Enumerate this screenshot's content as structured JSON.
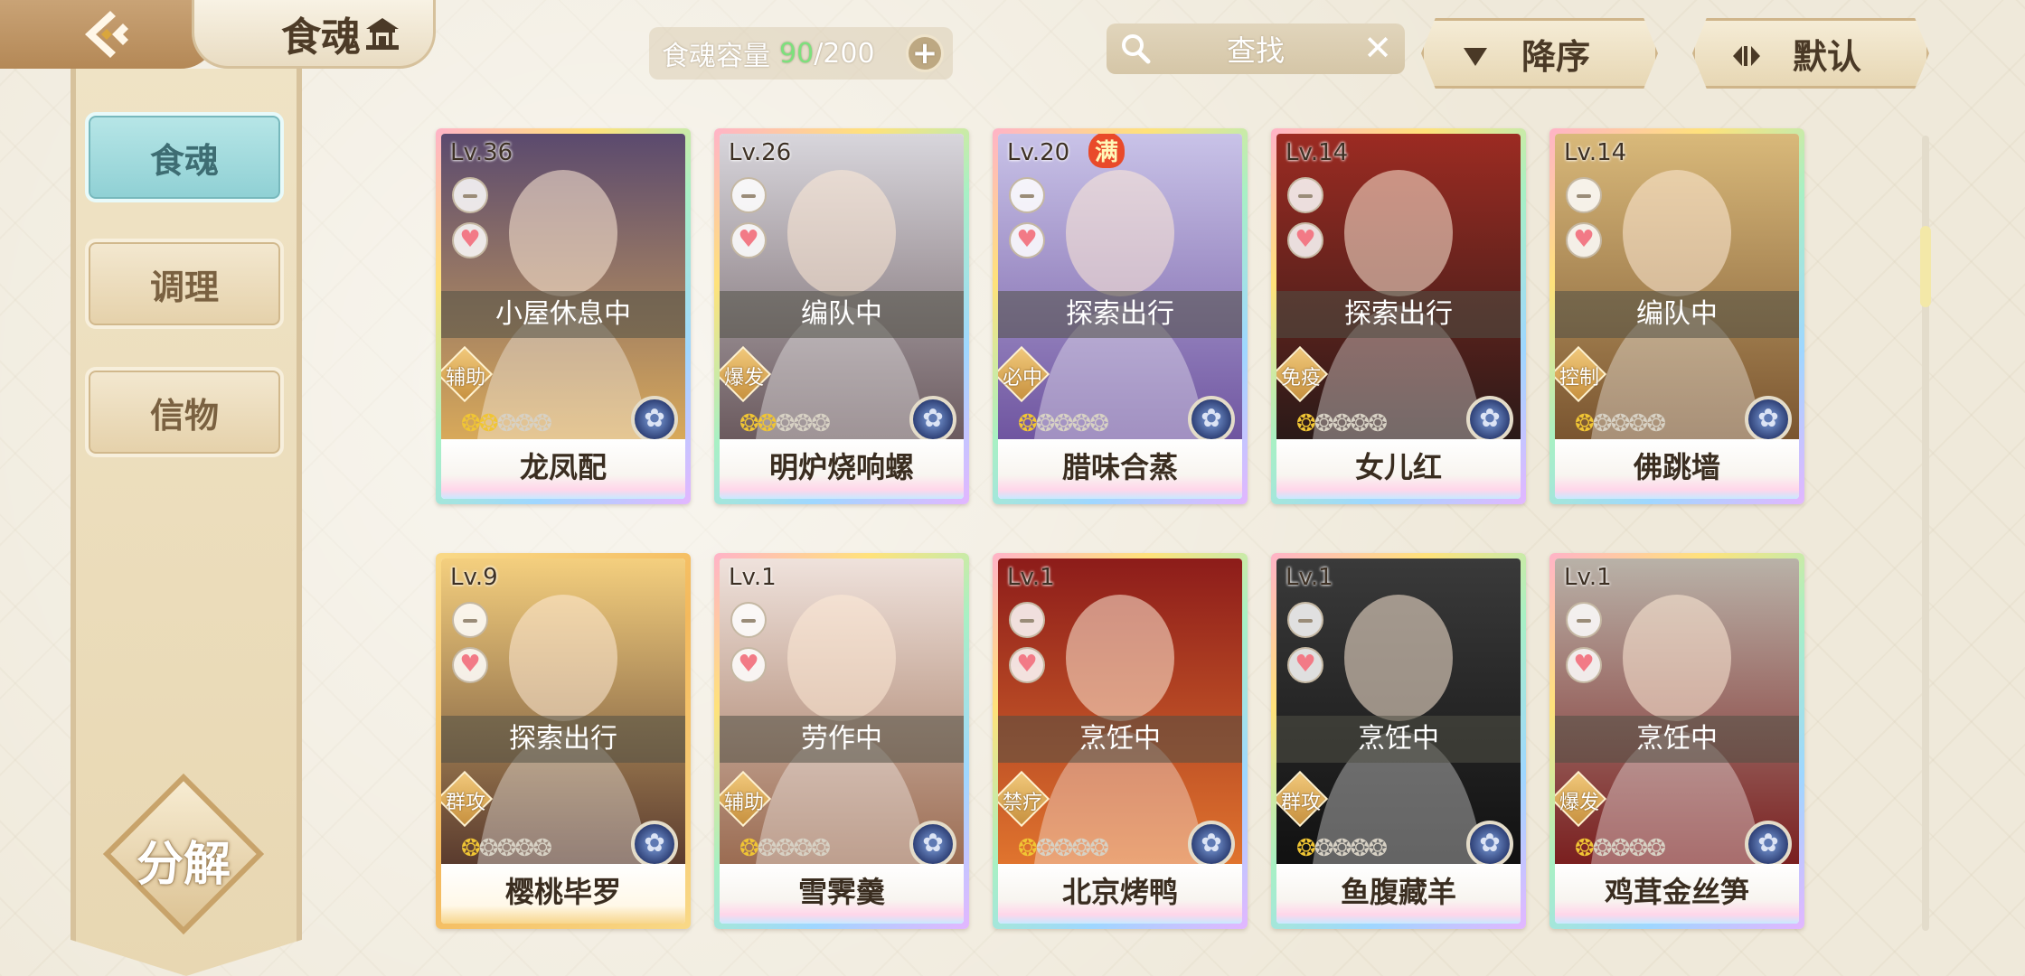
{
  "header": {
    "title": "食魂",
    "capacity_label": "食魂容量",
    "capacity_current": "90",
    "capacity_separator": "/",
    "capacity_max": "200",
    "capacity_add": "+",
    "search_placeholder": "查找",
    "search_clear": "✕",
    "sort_order_label": "降序",
    "sort_mode_label": "默认"
  },
  "sidebar": {
    "tabs": [
      {
        "label": "食魂",
        "active": true
      },
      {
        "label": "调理",
        "active": false
      },
      {
        "label": "信物",
        "active": false
      }
    ],
    "decompose_label": "分解"
  },
  "colors": {
    "accent_teal": "#8fd0d4",
    "gold": "#c8a36a",
    "capacity_green": "#7de07d"
  },
  "cards": [
    {
      "level": "Lv.36",
      "status": "小屋休息中",
      "role": "辅助",
      "flames_on": 2,
      "name": "龙凤配",
      "full": "",
      "bg": [
        "#5b4a6e",
        "#d8a95a"
      ],
      "frame": "rainbow"
    },
    {
      "level": "Lv.26",
      "status": "编队中",
      "role": "爆发",
      "flames_on": 2,
      "name": "明炉烧响螺",
      "full": "",
      "bg": [
        "#d8d6dc",
        "#6b5a5e"
      ],
      "frame": "rainbow"
    },
    {
      "level": "Lv.20",
      "status": "探索出行",
      "role": "必中",
      "flames_on": 1,
      "name": "腊味合蒸",
      "full": "满",
      "bg": [
        "#c9c3e8",
        "#6f55a0"
      ],
      "frame": "rainbow"
    },
    {
      "level": "Lv.14",
      "status": "探索出行",
      "role": "免疫",
      "flames_on": 1,
      "name": "女儿红",
      "full": "",
      "bg": [
        "#9c2b22",
        "#2a1a18"
      ],
      "frame": "rainbow"
    },
    {
      "level": "Lv.14",
      "status": "编队中",
      "role": "控制",
      "flames_on": 1,
      "name": "佛跳墙",
      "full": "",
      "bg": [
        "#d9b97a",
        "#7a5530"
      ],
      "frame": "rainbow"
    },
    {
      "level": "Lv.9",
      "status": "探索出行",
      "role": "群攻",
      "flames_on": 1,
      "name": "樱桃毕罗",
      "full": "",
      "bg": [
        "#f4cf7e",
        "#5a3b2e"
      ],
      "frame": "gold"
    },
    {
      "level": "Lv.1",
      "status": "劳作中",
      "role": "辅助",
      "flames_on": 1,
      "name": "雪霁羹",
      "full": "",
      "bg": [
        "#efe2dc",
        "#9b6c52"
      ],
      "frame": "rainbow"
    },
    {
      "level": "Lv.1",
      "status": "烹饪中",
      "role": "禁疗",
      "flames_on": 1,
      "name": "北京烤鸭",
      "full": "",
      "bg": [
        "#8d1c1a",
        "#e0742e"
      ],
      "frame": "rainbow"
    },
    {
      "level": "Lv.1",
      "status": "烹饪中",
      "role": "群攻",
      "flames_on": 1,
      "name": "鱼腹藏羊",
      "full": "",
      "bg": [
        "#3a3a3a",
        "#111111"
      ],
      "frame": "rainbow"
    },
    {
      "level": "Lv.1",
      "status": "烹饪中",
      "role": "爆发",
      "flames_on": 1,
      "name": "鸡茸金丝笋",
      "full": "",
      "bg": [
        "#b9b2a8",
        "#7a1f1f"
      ],
      "frame": "rainbow"
    }
  ]
}
